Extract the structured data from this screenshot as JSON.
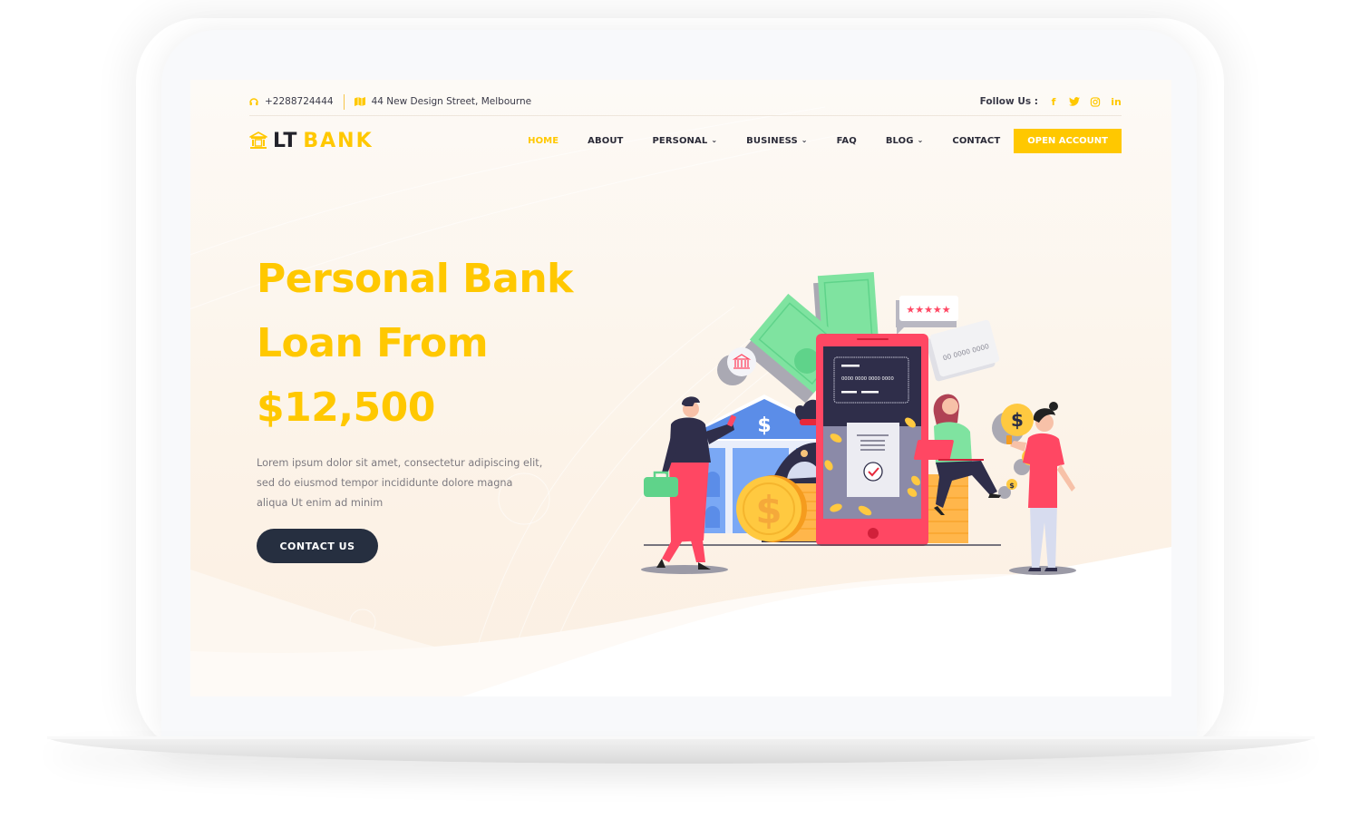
{
  "topbar": {
    "phone": "+2288724444",
    "address": "44 New Design Street, Melbourne",
    "follow_label": "Follow Us :",
    "social": [
      {
        "name": "facebook",
        "glyph": "f"
      },
      {
        "name": "twitter",
        "glyph": "t"
      },
      {
        "name": "instagram",
        "glyph": "◎"
      },
      {
        "name": "linkedin",
        "glyph": "in"
      }
    ]
  },
  "logo": {
    "part1": "LT",
    "part2": "BANK"
  },
  "nav": {
    "items": [
      {
        "label": "HOME",
        "active": true,
        "dropdown": false
      },
      {
        "label": "ABOUT",
        "active": false,
        "dropdown": false
      },
      {
        "label": "PERSONAL",
        "active": false,
        "dropdown": true
      },
      {
        "label": "BUSINESS",
        "active": false,
        "dropdown": true
      },
      {
        "label": "FAQ",
        "active": false,
        "dropdown": false
      },
      {
        "label": "BLOG",
        "active": false,
        "dropdown": true
      },
      {
        "label": "CONTACT",
        "active": false,
        "dropdown": false
      }
    ],
    "chevron": "⌄",
    "cta_label": "OPEN ACCOUNT"
  },
  "hero": {
    "title_lines": [
      "Personal Bank",
      "Loan From",
      "$12,500"
    ],
    "body": "Lorem ipsum dolor sit amet, consectetur adipiscing elit, sed do eiusmod tempor incididunte dolore magna aliqua Ut enim ad minim",
    "button_label": "CONTACT US"
  },
  "illustration": {
    "card_number": "0000 0000 0000 0000",
    "card_number_partial": "00 0000 0000",
    "rating_stars": "★★★★★",
    "dollar": "$"
  },
  "colors": {
    "accent": "#ffc800",
    "dark": "#262f40",
    "phone_red": "#ff4763",
    "money_green": "#7fe3a0",
    "bank_blue": "#7aa8f5"
  }
}
